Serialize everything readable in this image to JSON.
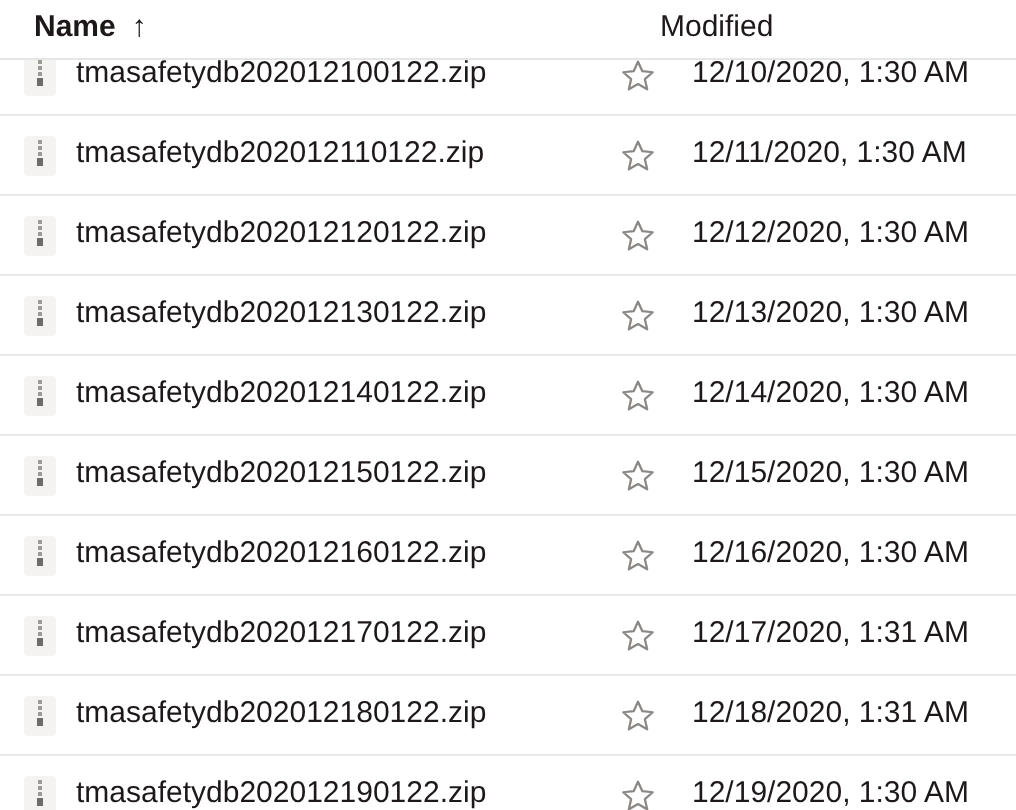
{
  "header": {
    "columns": [
      {
        "label": "Name",
        "sort_indicator": "↑"
      },
      {
        "label": "Modified"
      }
    ]
  },
  "files": [
    {
      "name": "tmasafetydb202012100122.zip",
      "starred": false,
      "modified": "12/10/2020, 1:30 AM"
    },
    {
      "name": "tmasafetydb202012110122.zip",
      "starred": false,
      "modified": "12/11/2020, 1:30 AM"
    },
    {
      "name": "tmasafetydb202012120122.zip",
      "starred": false,
      "modified": "12/12/2020, 1:30 AM"
    },
    {
      "name": "tmasafetydb202012130122.zip",
      "starred": false,
      "modified": "12/13/2020, 1:30 AM"
    },
    {
      "name": "tmasafetydb202012140122.zip",
      "starred": false,
      "modified": "12/14/2020, 1:30 AM"
    },
    {
      "name": "tmasafetydb202012150122.zip",
      "starred": false,
      "modified": "12/15/2020, 1:30 AM"
    },
    {
      "name": "tmasafetydb202012160122.zip",
      "starred": false,
      "modified": "12/16/2020, 1:30 AM"
    },
    {
      "name": "tmasafetydb202012170122.zip",
      "starred": false,
      "modified": "12/17/2020, 1:31 AM"
    },
    {
      "name": "tmasafetydb202012180122.zip",
      "starred": false,
      "modified": "12/18/2020, 1:31 AM"
    },
    {
      "name": "tmasafetydb202012190122.zip",
      "starred": false,
      "modified": "12/19/2020, 1:30 AM"
    }
  ]
}
